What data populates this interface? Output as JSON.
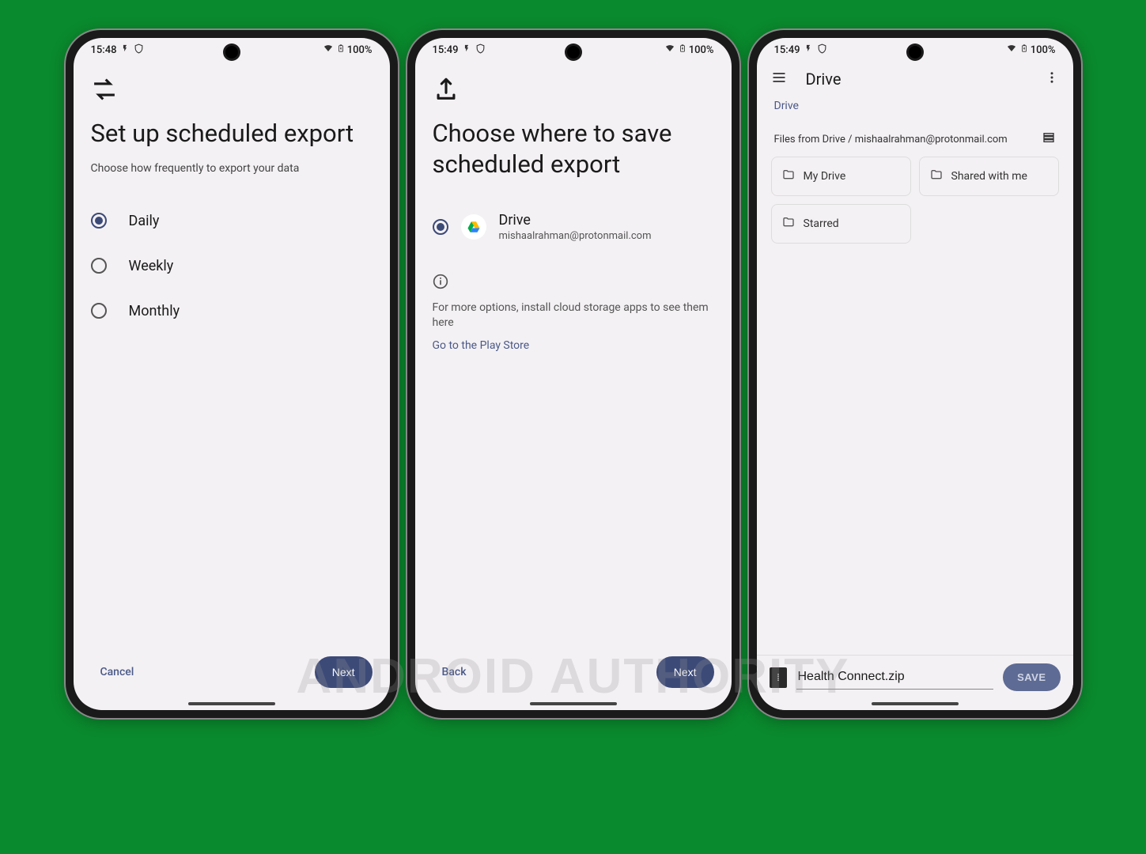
{
  "watermark": "ANDROID AUTHORITY",
  "status": {
    "wifi": "▾",
    "battery": "100%"
  },
  "screen1": {
    "time": "15:48",
    "title": "Set up scheduled export",
    "subtitle": "Choose how frequently to export your data",
    "options": [
      "Daily",
      "Weekly",
      "Monthly"
    ],
    "selected": 0,
    "cancel": "Cancel",
    "next": "Next"
  },
  "screen2": {
    "time": "15:49",
    "title": "Choose where to save scheduled export",
    "drive_name": "Drive",
    "drive_email": "mishaalrahman@protonmail.com",
    "info": "For more options, install cloud storage apps to see them here",
    "play_link": "Go to the Play Store",
    "back": "Back",
    "next": "Next"
  },
  "screen3": {
    "time": "15:49",
    "app_title": "Drive",
    "breadcrumb": "Drive",
    "files_header": "Files from Drive / mishaalrahman@protonmail.com",
    "folders": [
      "My Drive",
      "Shared with me",
      "Starred"
    ],
    "filename": "Health Connect.zip",
    "save": "SAVE"
  }
}
